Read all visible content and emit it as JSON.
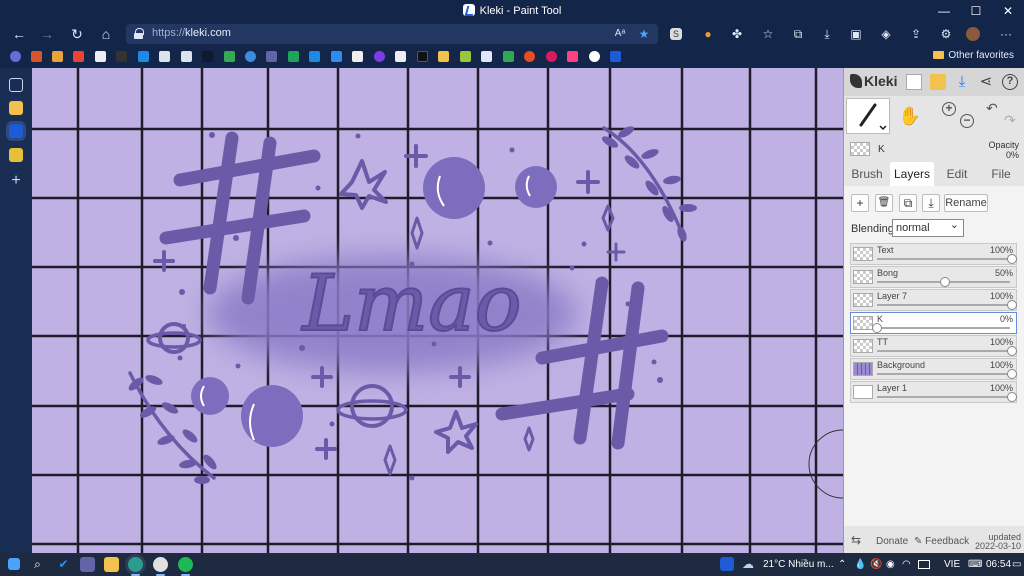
{
  "window": {
    "title": "Kleki - Paint Tool",
    "controls": {
      "minimize": "—",
      "maximize": "☐",
      "close": "✕"
    }
  },
  "browser": {
    "url_scheme": "https://",
    "url_host": "kleki.com",
    "nav": {
      "back": "←",
      "forward": "→",
      "refresh": "↻",
      "home": "⌂"
    },
    "toolbar_icons": [
      "read-aloud-icon",
      "favorite-star-icon",
      "extension-icon",
      "favorites-icon",
      "collections-icon",
      "downloads-icon",
      "more-icon"
    ],
    "more_label": "···",
    "favorites_bar": {
      "items_count_visible": 24,
      "other_favorites": "Other favorites"
    }
  },
  "kleki": {
    "logo": "Kleki",
    "current_layer": {
      "name": "K",
      "opacity_label": "Opacity",
      "opacity_value": "0%"
    },
    "tabs": [
      {
        "label": "Brush",
        "active": false
      },
      {
        "label": "Layers",
        "active": true
      },
      {
        "label": "Edit",
        "active": false
      },
      {
        "label": "File",
        "active": false
      }
    ],
    "layer_buttons": {
      "add": "+",
      "delete": "🗑",
      "duplicate": "⧉",
      "merge": "⤓",
      "rename": "Rename"
    },
    "blending": {
      "label": "Blending",
      "value": "normal"
    },
    "layers": [
      {
        "name": "Text",
        "opacity": "100%",
        "fraction": 1.0,
        "selected": false,
        "thumb": "checker"
      },
      {
        "name": "Bong",
        "opacity": "50%",
        "fraction": 0.5,
        "selected": false,
        "thumb": "checker"
      },
      {
        "name": "Layer 7",
        "opacity": "100%",
        "fraction": 1.0,
        "selected": false,
        "thumb": "checker"
      },
      {
        "name": "K",
        "opacity": "0%",
        "fraction": 0.0,
        "selected": true,
        "thumb": "checker"
      },
      {
        "name": "TT",
        "opacity": "100%",
        "fraction": 1.0,
        "selected": false,
        "thumb": "checker"
      },
      {
        "name": "Background",
        "opacity": "100%",
        "fraction": 1.0,
        "selected": false,
        "thumb": "purple"
      },
      {
        "name": "Layer 1",
        "opacity": "100%",
        "fraction": 1.0,
        "selected": false,
        "thumb": "white"
      }
    ],
    "bottom": {
      "donate": "Donate",
      "feedback": "Feedback",
      "updated_label": "updated",
      "updated_date": "2022-03-10"
    }
  },
  "canvas": {
    "text": "Lmao",
    "colors": {
      "background": "#bfb1e3",
      "ink": "#6b5aa8",
      "grid": "#1c1c2a"
    }
  },
  "taskbar": {
    "weather": "21°C Nhiều m...",
    "language": "VIE",
    "time": "06:54"
  },
  "colors": {
    "accent": "#1e5bd6",
    "chrome": "#14254a"
  }
}
